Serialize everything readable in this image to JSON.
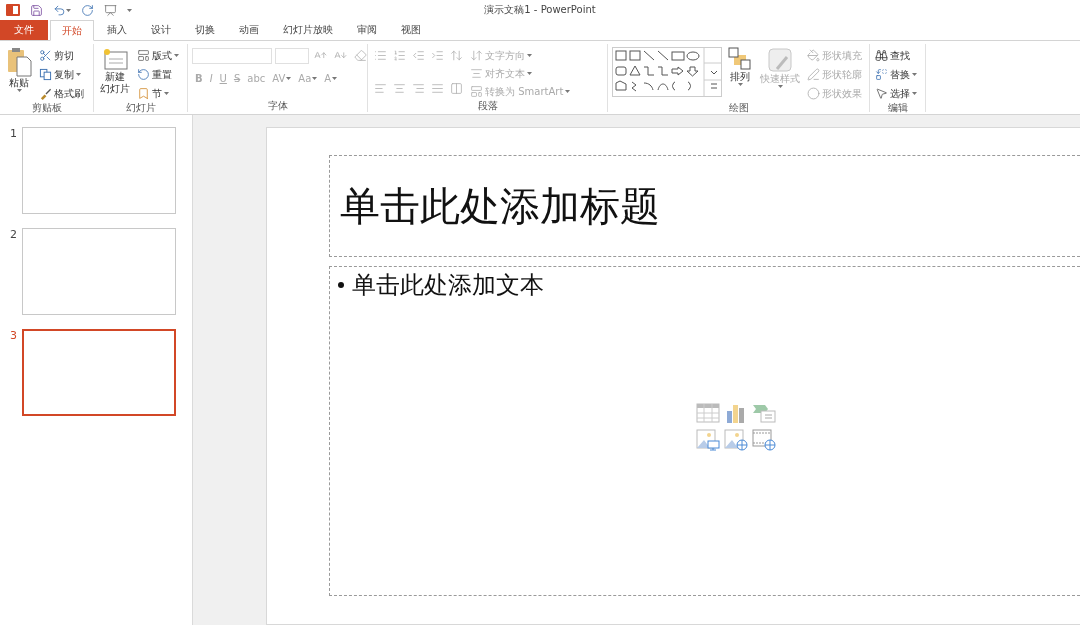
{
  "window": {
    "title": "演示文稿1 - PowerPoint"
  },
  "tabs": [
    {
      "label": "文件",
      "kind": "file",
      "selected": false
    },
    {
      "label": "开始",
      "kind": "tab",
      "selected": true
    },
    {
      "label": "插入",
      "kind": "tab",
      "selected": false
    },
    {
      "label": "设计",
      "kind": "tab",
      "selected": false
    },
    {
      "label": "切换",
      "kind": "tab",
      "selected": false
    },
    {
      "label": "动画",
      "kind": "tab",
      "selected": false
    },
    {
      "label": "幻灯片放映",
      "kind": "tab",
      "selected": false
    },
    {
      "label": "审阅",
      "kind": "tab",
      "selected": false
    },
    {
      "label": "视图",
      "kind": "tab",
      "selected": false
    }
  ],
  "ribbon": {
    "clipboard": {
      "label": "剪贴板",
      "paste": {
        "label": "粘贴"
      },
      "items": [
        {
          "label": "剪切",
          "dropdown": false
        },
        {
          "label": "复制",
          "dropdown": true
        },
        {
          "label": "格式刷",
          "dropdown": false
        }
      ]
    },
    "slides": {
      "label": "幻灯片",
      "new_slide": {
        "lines": [
          "新建",
          "幻灯片"
        ]
      },
      "items": [
        {
          "label": "版式",
          "dropdown": true
        },
        {
          "label": "重置",
          "dropdown": false
        },
        {
          "label": "节",
          "dropdown": true
        }
      ]
    },
    "font": {
      "label": "字体",
      "disabled": true,
      "format_buttons": [
        {
          "label": "B",
          "dropdown": false
        },
        {
          "label": "I",
          "dropdown": false
        },
        {
          "label": "U",
          "dropdown": false
        },
        {
          "label": "S",
          "dropdown": false
        },
        {
          "label": "abc",
          "dropdown": false
        },
        {
          "label": "AV",
          "dropdown": true
        },
        {
          "label": "Aa",
          "dropdown": true
        },
        {
          "label": "A",
          "dropdown": true
        }
      ]
    },
    "paragraph": {
      "label": "段落",
      "disabled": true,
      "items": [
        {
          "label": "文字方向",
          "dropdown": true
        },
        {
          "label": "对齐文本",
          "dropdown": true
        },
        {
          "label": "转换为 SmartArt",
          "dropdown": true
        }
      ]
    },
    "drawing": {
      "label": "绘图",
      "arrange": {
        "label": "排列",
        "disabled": false
      },
      "quick_styles": {
        "label": "快速样式",
        "disabled": true
      },
      "items": [
        {
          "label": "形状填充",
          "disabled": true
        },
        {
          "label": "形状轮廓",
          "disabled": true
        },
        {
          "label": "形状效果",
          "disabled": true
        }
      ]
    },
    "editing": {
      "label": "编辑",
      "items": [
        {
          "label": "查找",
          "dropdown": false
        },
        {
          "label": "替换",
          "dropdown": true
        },
        {
          "label": "选择",
          "dropdown": true
        }
      ]
    }
  },
  "slides": [
    {
      "number": "1",
      "selected": false
    },
    {
      "number": "2",
      "selected": false
    },
    {
      "number": "3",
      "selected": true
    }
  ],
  "slide": {
    "title_placeholder": "单击此处添加标题",
    "body_placeholder": "单击此处添加文本"
  }
}
